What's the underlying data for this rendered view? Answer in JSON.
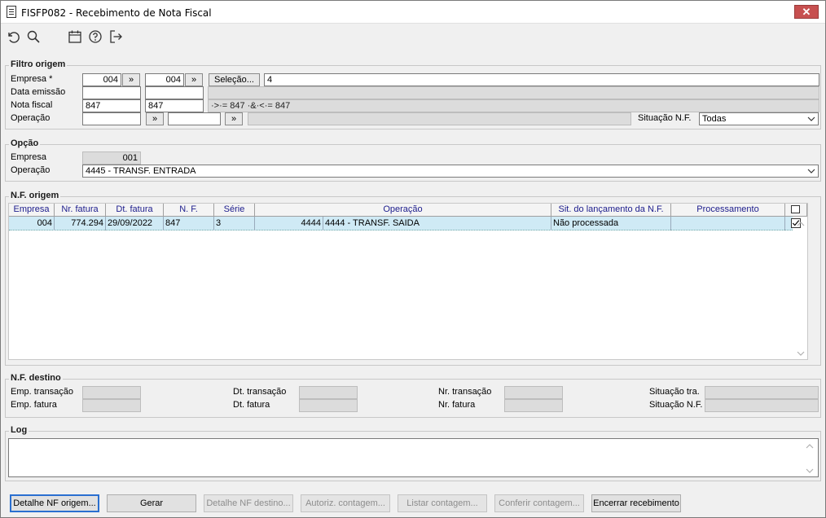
{
  "window": {
    "title": "FISFP082 - Recebimento de Nota Fiscal",
    "close": "✕"
  },
  "toolbar": {
    "icons": [
      "undo-icon",
      "search-icon",
      "calendar-icon",
      "help-icon",
      "exit-icon"
    ]
  },
  "filtro": {
    "title": "Filtro origem",
    "empresa_label": "Empresa *",
    "empresa_from": "004",
    "empresa_to": "004",
    "arrow": "»",
    "selecao_label": "Seleção...",
    "selecao_value": "4",
    "data_emissao_label": "Data emissão",
    "nota_fiscal_label": "Nota fiscal",
    "nota_from": "847",
    "nota_to": "847",
    "nota_expr": "·>·= 847 ·&·<·= 847",
    "operacao_label": "Operação",
    "situacao_label": "Situação N.F.",
    "situacao_value": "Todas"
  },
  "opcao": {
    "title": "Opção",
    "empresa_label": "Empresa",
    "empresa_value": "001",
    "operacao_label": "Operação",
    "operacao_value": "4445 - TRANSF. ENTRADA"
  },
  "nf_origem": {
    "title": "N.F. origem",
    "columns": [
      "Empresa",
      "Nr. fatura",
      "Dt. fatura",
      "N. F.",
      "Série",
      "Operação",
      "Sit. do lançamento da N.F.",
      "Processamento"
    ],
    "rows": [
      {
        "empresa": "004",
        "nr_fatura": "774.294",
        "dt_fatura": "29/09/2022",
        "nf": "847",
        "serie": "3",
        "op_code": "4444",
        "op_desc": "4444 - TRANSF. SAIDA",
        "situacao": "Não processada",
        "processamento": "",
        "checked": true
      }
    ]
  },
  "nf_destino": {
    "title": "N.F. destino",
    "emp_transacao": "Emp. transação",
    "emp_fatura": "Emp. fatura",
    "dt_transacao": "Dt. transação",
    "dt_fatura": "Dt. fatura",
    "nr_transacao": "Nr. transação",
    "nr_fatura": "Nr. fatura",
    "situacao_tra": "Situação tra.",
    "situacao_nf": "Situação N.F."
  },
  "log": {
    "title": "Log"
  },
  "buttons": {
    "detalhe_origem": "Detalhe NF origem...",
    "gerar": "Gerar",
    "detalhe_destino": "Detalhe NF destino...",
    "autoriz": "Autoriz. contagem...",
    "listar": "Listar contagem...",
    "conferir": "Conferir contagem...",
    "encerrar": "Encerrar recebimento"
  }
}
